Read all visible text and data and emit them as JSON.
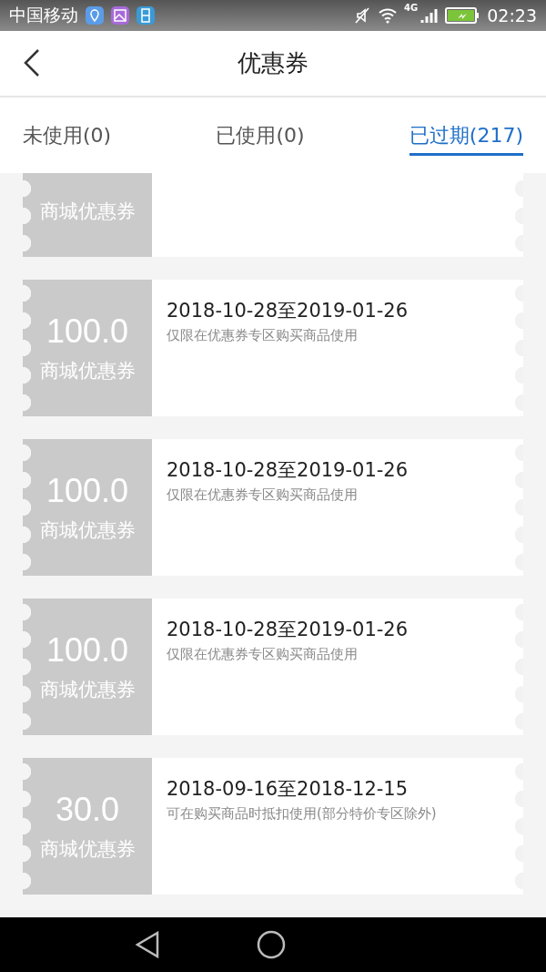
{
  "status_bar": {
    "carrier": "中国移动",
    "network": "4G",
    "time": "02:23"
  },
  "header": {
    "title": "优惠券"
  },
  "tabs": [
    {
      "label": "未使用(0)",
      "selected": false
    },
    {
      "label": "已使用(0)",
      "selected": false
    },
    {
      "label": "已过期(217)",
      "selected": true
    }
  ],
  "coupons": [
    {
      "label": "商城优惠券"
    },
    {
      "amount": "100.0",
      "label": "商城优惠券",
      "validity": "2018-10-28至2019-01-26",
      "note": "仅限在优惠券专区购买商品使用"
    },
    {
      "amount": "100.0",
      "label": "商城优惠券",
      "validity": "2018-10-28至2019-01-26",
      "note": "仅限在优惠券专区购买商品使用"
    },
    {
      "amount": "100.0",
      "label": "商城优惠券",
      "validity": "2018-10-28至2019-01-26",
      "note": "仅限在优惠券专区购买商品使用"
    },
    {
      "amount": "30.0",
      "label": "商城优惠券",
      "validity": "2018-09-16至2018-12-15",
      "note": "可在购买商品时抵扣使用(部分特价专区除外)"
    }
  ]
}
